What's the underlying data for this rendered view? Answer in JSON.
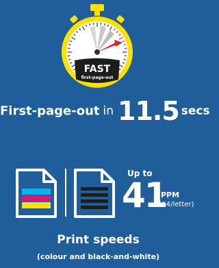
{
  "stopwatch": {
    "badge": "FAST",
    "caption": "first-page-out",
    "colors": {
      "ring": "#ffe000",
      "needle": "#e4202e",
      "face": "#ffffff",
      "ticks": "#333333"
    }
  },
  "first_page": {
    "label": "First-page-out",
    "connector": "in",
    "value": "11.5",
    "unit": "secs"
  },
  "print_speed": {
    "up_to": "Up to",
    "value": "41",
    "unit": "PPM",
    "paper": "(A4/letter)",
    "title": "Print speeds",
    "subtitle": "(colour and black-and-white)"
  },
  "icons": {
    "colour_doc": "colour-document-icon",
    "mono_doc": "mono-document-icon",
    "stopwatch": "stopwatch-icon"
  },
  "colors": {
    "background": "#1f5e9a",
    "cyan": "#00b7ea",
    "magenta": "#e2137d",
    "yellow": "#ffe100",
    "text": "#ffffff"
  }
}
